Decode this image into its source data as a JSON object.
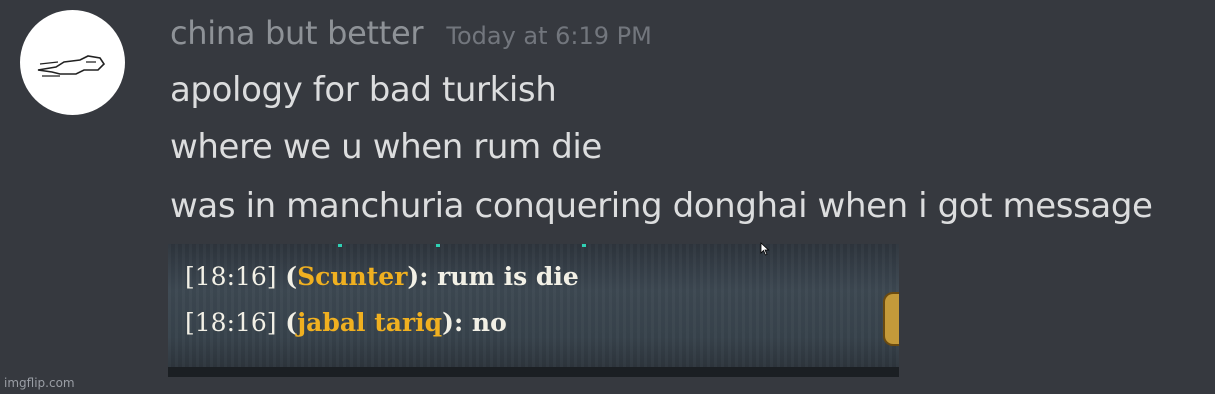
{
  "message": {
    "username": "china but better",
    "timestamp": "Today at 6:19 PM",
    "lines": [
      "apology for bad turkish",
      "where we u when rum die",
      "was in manchuria conquering donghai when i got message"
    ]
  },
  "attachment": {
    "chat": [
      {
        "time": "[18:16]",
        "open": " (",
        "name": "Scunter",
        "text": "): rum is die"
      },
      {
        "time": "[18:16]",
        "open": " (",
        "name": "jabal tariq",
        "text": "): no"
      }
    ]
  },
  "watermark": "imgflip.com",
  "colors": {
    "background": "#36393f",
    "username": "#8e9297",
    "message_text": "#dcddde",
    "chat_name": "#f0b020"
  },
  "icons": [
    "avatar-doodle-icon",
    "mouse-cursor-icon"
  ]
}
